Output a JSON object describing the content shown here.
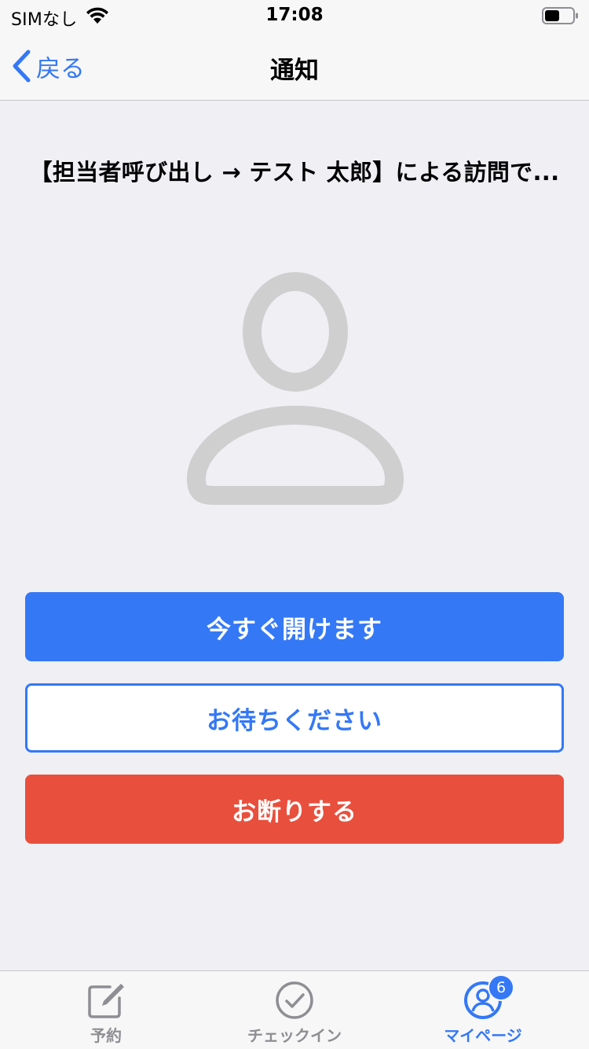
{
  "status_bar": {
    "carrier": "SIMなし",
    "time": "17:08",
    "wifi_icon": "wifi-icon",
    "battery_icon": "battery-icon"
  },
  "nav": {
    "back_label": "戻る",
    "title": "通知"
  },
  "message": "【担当者呼び出し → テスト 太郎】による訪問で...",
  "avatar_icon": "person-placeholder-icon",
  "buttons": {
    "open_now": "今すぐ開けます",
    "please_wait": "お待ちください",
    "decline": "お断りする"
  },
  "tabs": [
    {
      "label": "予約",
      "icon": "compose-icon",
      "active": false
    },
    {
      "label": "チェックイン",
      "icon": "checkmark-circle-icon",
      "active": false
    },
    {
      "label": "マイページ",
      "icon": "person-circle-icon",
      "active": true,
      "badge": "6"
    }
  ],
  "colors": {
    "accent": "#3478f6",
    "decline": "#e94f3d",
    "background": "#efeff4",
    "inactive_tab": "#8e8e93",
    "placeholder": "#cfcfcf"
  }
}
